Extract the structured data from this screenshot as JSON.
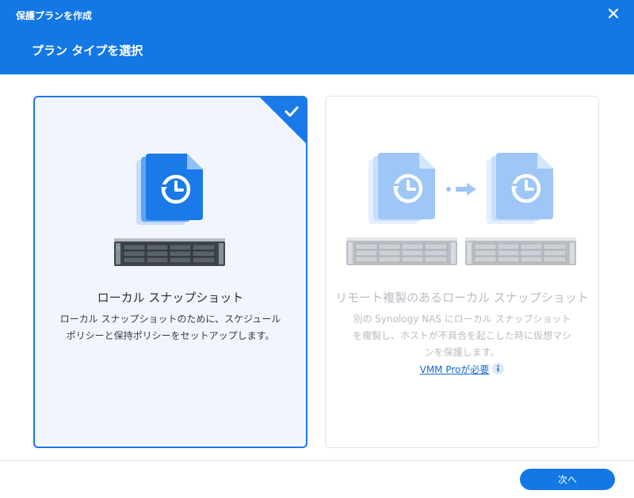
{
  "window": {
    "title": "保護プランを作成"
  },
  "header": {
    "subtitle": "プラン タイプを選択"
  },
  "cards": [
    {
      "title": "ローカル スナップショット",
      "description_lines": [
        "ローカル スナップショットのために、スケジュール",
        "ポリシーと保持ポリシーをセットアップします。"
      ],
      "selected": true
    },
    {
      "title": "リモート複製のあるローカル スナップショット",
      "description_lines": [
        "別の Synology NAS にローカル スナップショット",
        "を複製し、ホストが不具合を起こした時に仮想マシ",
        "ンを保護します。"
      ],
      "link": "VMM Proが必要",
      "selected": false
    }
  ],
  "footer": {
    "next_label": "次へ"
  },
  "icons": {
    "close": "close-icon",
    "check": "check-icon",
    "snapshot": "snapshot-file-icon",
    "nas": "nas-device-icon",
    "arrow": "replication-arrow-icon",
    "info": "info-icon"
  },
  "colors": {
    "header": "#1378e6",
    "accent": "#1a7ae8",
    "selected_card_bg": "#f1f6fe",
    "disabled_text": "#b7bcc3",
    "link": "#1468d8"
  }
}
